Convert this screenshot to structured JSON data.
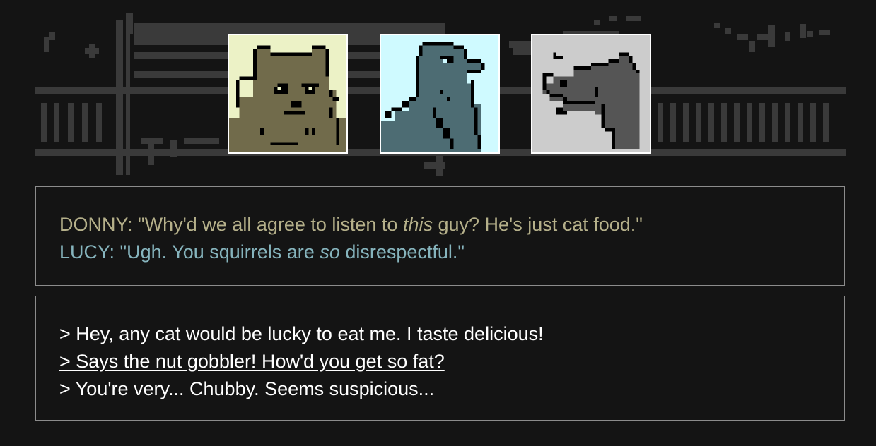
{
  "scene": {
    "background_color": "#141414",
    "portraits": [
      {
        "character": "squirrel",
        "icon": "squirrel-portrait",
        "bg": "#ecf2c6",
        "fg": "#716b4b"
      },
      {
        "character": "pigeon",
        "icon": "pigeon-portrait",
        "bg": "#cffaff",
        "fg": "#4d6c73"
      },
      {
        "character": "dog",
        "icon": "dog-portrait",
        "bg": "#cccccc",
        "fg": "#555555"
      }
    ]
  },
  "dialogue": {
    "lines": [
      {
        "speaker": "DONNY",
        "color": "#b5b08a",
        "pre": ": \"Why'd we all agree to listen to ",
        "emphasis": "this",
        "post": " guy? He's just cat food.\""
      },
      {
        "speaker": "LUCY",
        "color": "#86b4bd",
        "pre": ": \"Ugh. You squirrels are ",
        "emphasis": "so",
        "post": " disrespectful.\""
      }
    ]
  },
  "choices": {
    "selected_index": 1,
    "items": [
      {
        "text": "> Hey, any cat would be lucky to eat me. I taste delicious!"
      },
      {
        "text": "> Says the nut gobbler! How'd you get so fat?"
      },
      {
        "text": "> You're very... Chubby. Seems suspicious..."
      }
    ]
  }
}
